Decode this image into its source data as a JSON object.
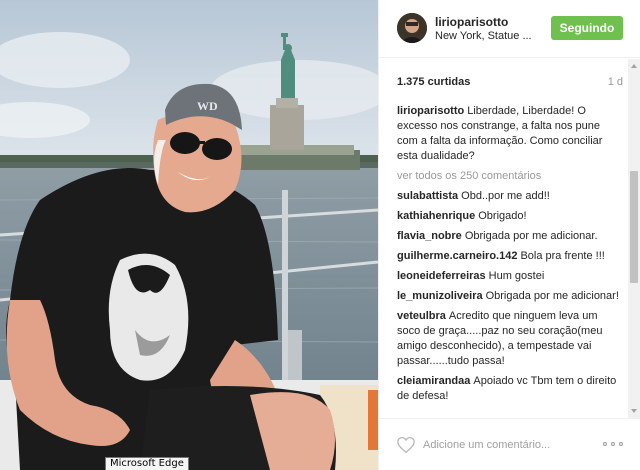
{
  "post": {
    "photo_alt": "lirioparisotto photo",
    "tooltip": "Microsoft Edge"
  },
  "header": {
    "username": "lirioparisotto",
    "location": "New York, Statue ...",
    "follow_label": "Seguindo",
    "follow_color": "#70c050"
  },
  "stats": {
    "likes": "1.375 curtidas",
    "time": "1 d"
  },
  "caption": {
    "author": "lirioparisotto",
    "text": "Liberdade, Liberdade! O excesso nos constrange, a falta nos pune com a falta da informação. Como conciliar esta dualidade?"
  },
  "view_all": "ver todos os 250 comentários",
  "comments": [
    {
      "author": "sulabattista",
      "text": "Obd..por me add!!"
    },
    {
      "author": "kathiahenrique",
      "text": "Obrigado!"
    },
    {
      "author": "flavia_nobre",
      "text": "Obrigada por me adicionar."
    },
    {
      "author": "guilherme.carneiro.142",
      "text": "Bola pra frente !!!"
    },
    {
      "author": "leoneideferreiras",
      "text": "Hum gostei"
    },
    {
      "author": "le_munizoliveira",
      "text": "Obrigada por me adicionar!"
    },
    {
      "author": "veteulbra",
      "text": "Acredito que ninguem leva um soco de graça.....paz no seu coração(meu amigo desconhecido), a tempestade vai passar......tudo passa!"
    },
    {
      "author": "cleiamirandaa",
      "text": "Apoiado vc Tbm tem o direito de defesa!"
    }
  ],
  "footer": {
    "add_comment_placeholder": "Adicione um comentário...",
    "like_icon": "heart-icon",
    "more_icon": "more-options-icon"
  }
}
